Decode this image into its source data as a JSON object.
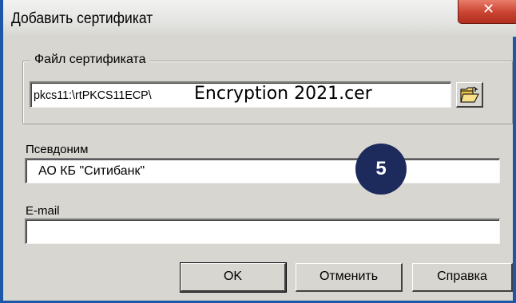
{
  "window": {
    "title": "Добавить сертификат",
    "close_icon": "close-icon",
    "close_glyph": "✕"
  },
  "certificate_file": {
    "group_label": "Файл сертификата",
    "value_prefix": "pkcs11:\\rtPKCS11ECP\\",
    "value_filename": "Encryption 2021.cer",
    "browse_icon": "folder-open-icon"
  },
  "alias": {
    "label": "Псевдоним",
    "value": "АО КБ \"Ситибанк\""
  },
  "email": {
    "label": "E-mail",
    "value": ""
  },
  "buttons": {
    "ok": "OK",
    "cancel": "Отменить",
    "help": "Справка"
  },
  "step_badge": "5",
  "colors": {
    "dialog_bg": "#d8d6d0",
    "frame_blue": "#1d57a8",
    "close_red": "#c84331",
    "badge_navy": "#1c2a5c"
  }
}
